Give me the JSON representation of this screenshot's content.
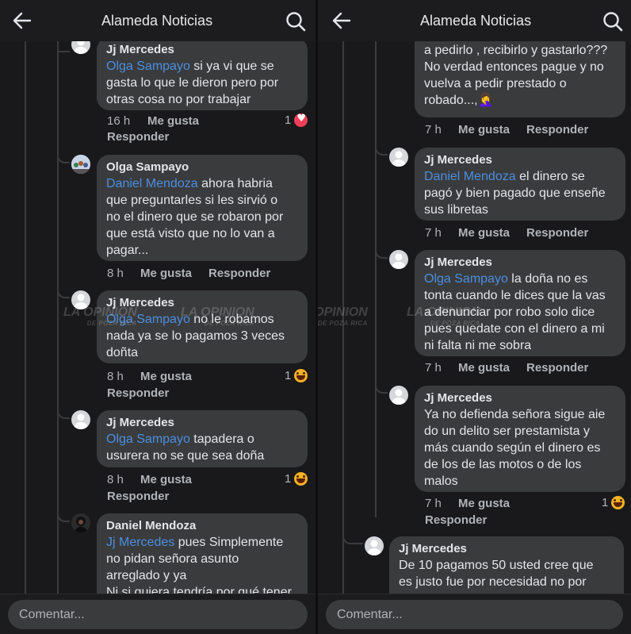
{
  "app": {
    "title": "Alameda Noticias",
    "comment_placeholder": "Comentar..."
  },
  "colors": {
    "background": "#19191b",
    "bubble": "#3a3b3c",
    "mention": "#4b8fe2",
    "meta": "#b0b3b8"
  },
  "icons": {
    "back": "back-arrow-icon",
    "search": "search-icon",
    "reaction_heart": "heart-reaction-icon",
    "reaction_haha": "haha-reaction-icon"
  },
  "watermark": "LA OPINION DE POZA RICA",
  "actions": {
    "like": "Me gusta",
    "reply": "Responder"
  },
  "panel_left": {
    "comments": [
      {
        "author": "Jj Mercedes",
        "mention": "Olga Sampayo",
        "text": " si ya vi que se\ngasta lo que le dieron pero por\notras cosa no por trabajar",
        "time": "16 h",
        "reactions": "1"
      },
      {
        "author": "Olga Sampayo",
        "mention": "Daniel Mendoza",
        "text": " ahora habria\nque preguntarles si les sirvió o\nno el dinero que se robaron por\nque está visto que no lo van a\npagar...",
        "time": "8 h",
        "reactions": ""
      },
      {
        "author": "Jj Mercedes",
        "mention": "Olga Sampayo",
        "text": " no le robamos\nnada ya se lo pagamos 3 veces\ndoñta",
        "time": "8 h",
        "reactions": "1"
      },
      {
        "author": "Jj Mercedes",
        "mention": "Olga Sampayo",
        "text": " tapadera o\nusurera no se que sea doña",
        "time": "8 h",
        "reactions": "1"
      },
      {
        "author": "Daniel Mendoza",
        "mention": "Jj Mercedes",
        "text": " pues  Simplemente\nno pidan señora asunto\narreglado y ya\nNi si quiera tendría por qué tener",
        "time": "",
        "reactions": ""
      }
    ]
  },
  "panel_right": {
    "comments": [
      {
        "author": "",
        "mention": "",
        "text": "el dinero o acaso  los obligaron\na pedirlo , recibirlo y gastarlo???\nNo verdad entonces pague y no\nvuelva a pedir prestado o\nrobado...,🤦‍♀️",
        "time": "7 h",
        "reactions": ""
      },
      {
        "author": "Jj Mercedes",
        "mention": "Daniel Mendoza",
        "text": " el dinero se\npagó y bien pagado que enseñe\nsus libretas",
        "time": "7 h",
        "reactions": ""
      },
      {
        "author": "Jj Mercedes",
        "mention": "Olga Sampayo",
        "text": " la doña no es\ntonta cuando le dices que la vas\na denunciar por robo solo dice\npues quedate  con el dinero a mi\nni falta ni me sobra",
        "time": "7 h",
        "reactions": ""
      },
      {
        "author": "Jj Mercedes",
        "mention": "",
        "text": "Ya no defienda señora sigue aie\ndo un delito ser prestamista y\nmás cuando según el dinero es\nde los de las motos o de los\nmalos",
        "time": "7 h",
        "reactions": "1"
      },
      {
        "author": "Jj Mercedes",
        "mention": "",
        "text": "De 10 pagamos 50 usted cree que\nes justo fue por necesidad no por",
        "time": "",
        "reactions": ""
      }
    ]
  }
}
